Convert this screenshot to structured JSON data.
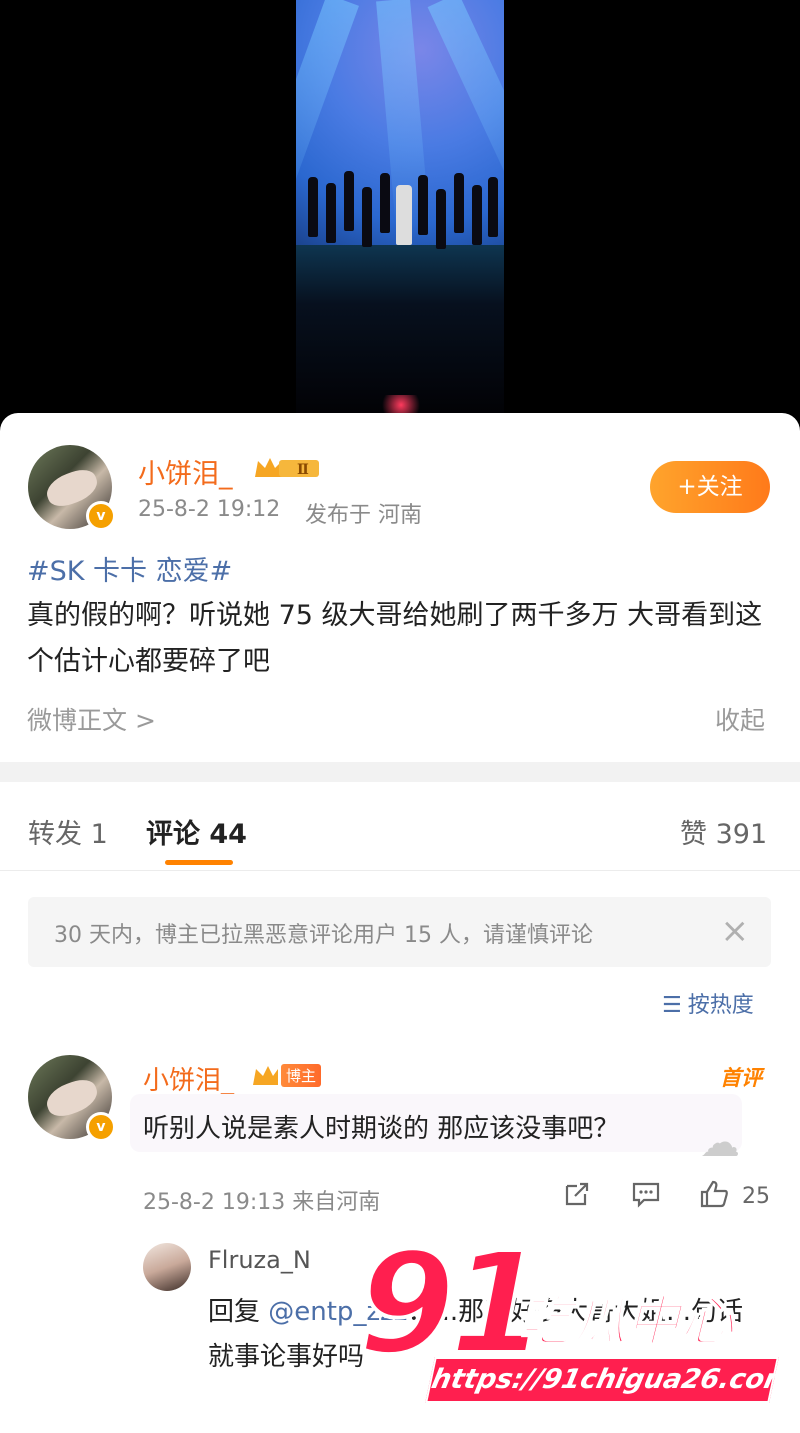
{
  "post": {
    "author": "小饼泪_",
    "rank_badge": "Ⅱ",
    "time": "25-8-2 19:12",
    "location": "发布于 河南",
    "follow_label": "+关注",
    "hashtag": "#SK 卡卡 恋爱#",
    "text": "真的假的啊？听说她 75 级大哥给她刷了两千多万 大哥看到这个估计心都要碎了吧",
    "weibo_link": "微博正文 >",
    "collapse_label": "收起"
  },
  "tabs": {
    "repost": "转发 1",
    "comments": "评论 44",
    "likes": "赞 391"
  },
  "notice": {
    "text": "30 天内，博主已拉黑恶意评论用户 15 人，请谨慎评论",
    "close": "×"
  },
  "sort": {
    "icon": "sort-icon",
    "label": "按热度"
  },
  "comment": {
    "author": "小饼泪_",
    "blogger_tag": "博主",
    "first_comment_tag": "首评",
    "text": "听别人说是素人时期谈的 那应该没事吧？",
    "time_location": "25-8-2 19:13 来自河南",
    "like_count": "25"
  },
  "reply": {
    "author": "Flruza_N",
    "prefix": "回复 ",
    "mention": "@entp_zzz",
    "text": "：...那天好多大哥大姐...句话 就事论事好吗"
  },
  "watermark": {
    "number": "91",
    "name": "吃瓜中心",
    "url": "https://91chigua26.com"
  }
}
